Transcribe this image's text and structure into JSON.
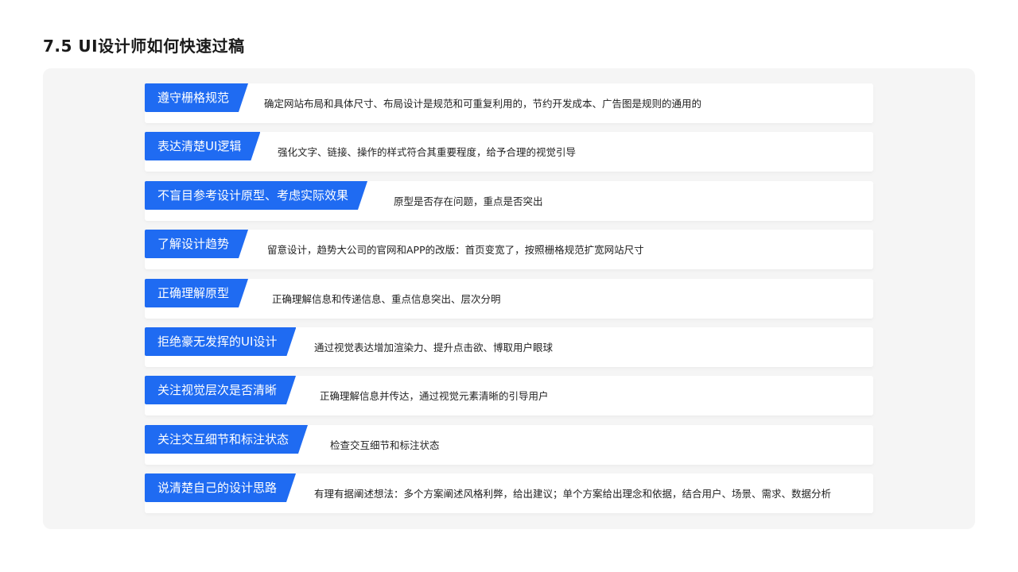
{
  "title": "7.5 UI设计师如何快速过稿",
  "colors": {
    "accent": "#1f6bf2",
    "panel": "#f5f5f5",
    "card": "#ffffff"
  },
  "items": [
    {
      "label": "遵守栅格规范",
      "desc": "确定网站布局和具体尺寸、布局设计是规范和可重复利用的，节约开发成本、广告图是规则的通用的"
    },
    {
      "label": "表达清楚UI逻辑",
      "desc": "强化文字、链接、操作的样式符合其重要程度，给予合理的视觉引导"
    },
    {
      "label": "不盲目参考设计原型、考虑实际效果",
      "desc": "原型是否存在问题，重点是否突出"
    },
    {
      "label": "了解设计趋势",
      "desc": "留意设计，趋势大公司的官网和APP的改版：首页变宽了，按照栅格规范扩宽网站尺寸"
    },
    {
      "label": "正确理解原型",
      "desc": "正确理解信息和传递信息、重点信息突出、层次分明"
    },
    {
      "label": "拒绝豪无发挥的UI设计",
      "desc": "通过视觉表达增加渲染力、提升点击欲、博取用户眼球"
    },
    {
      "label": "关注视觉层次是否清晰",
      "desc": "正确理解信息并传达，通过视觉元素清晰的引导用户"
    },
    {
      "label": "关注交互细节和标注状态",
      "desc": "检查交互细节和标注状态"
    },
    {
      "label": "说清楚自己的设计思路",
      "desc": "有理有据阐述想法：多个方案阐述风格利弊，给出建议；单个方案给出理念和依据，结合用户、场景、需求、数据分析"
    }
  ]
}
